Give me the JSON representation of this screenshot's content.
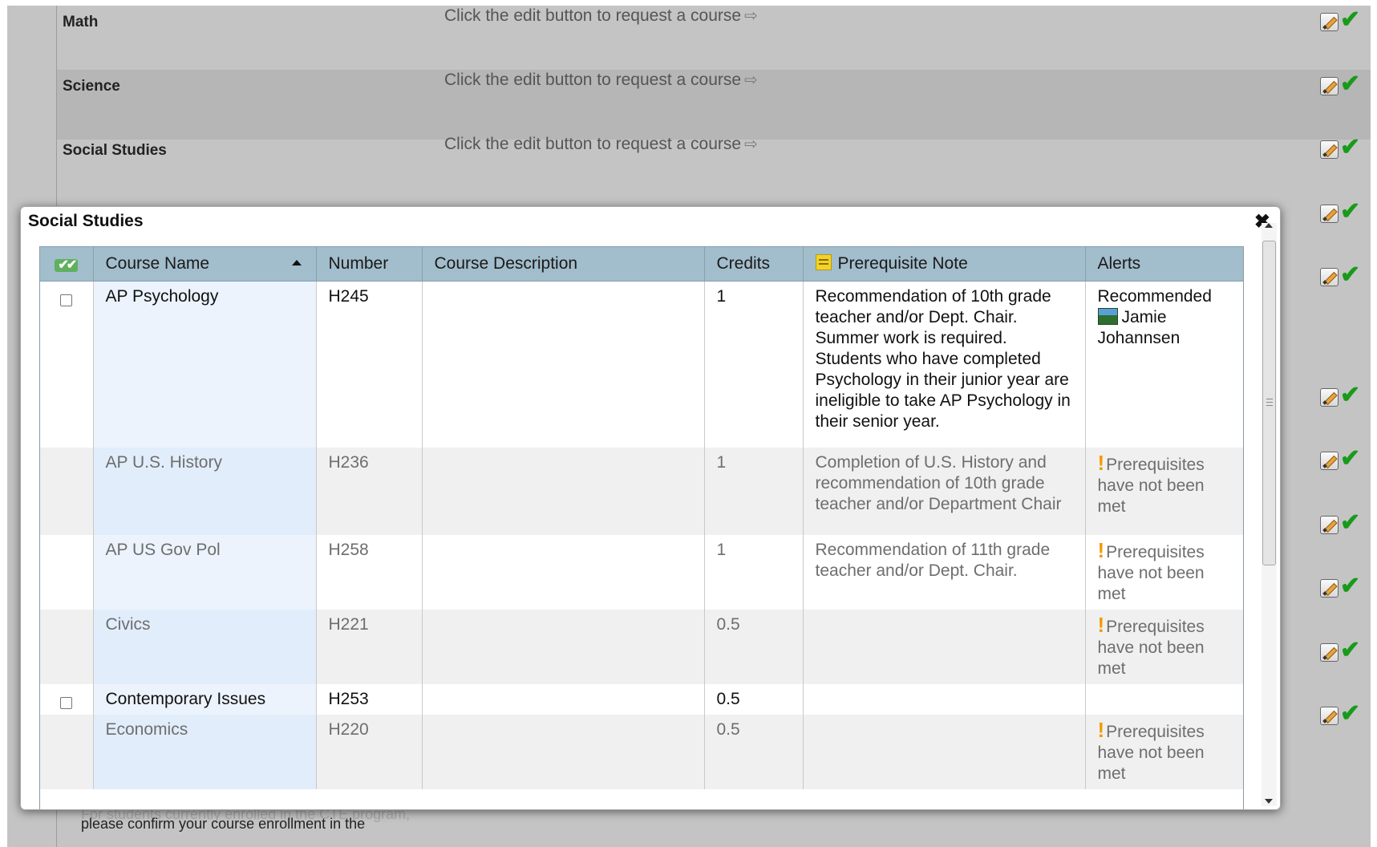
{
  "background": {
    "rows": [
      {
        "subject": "Math",
        "hint": "Click the edit button to request a course",
        "alt": false
      },
      {
        "subject": "Science",
        "hint": "Click the edit button to request a course",
        "alt": true
      },
      {
        "subject": "Social Studies",
        "hint": "Click the edit button to request a course",
        "alt": false
      }
    ],
    "footer_text": "please confirm your course enrollment in the",
    "footer_obscured_text": "For students currently enrolled in the CTE program,"
  },
  "modal": {
    "title": "Social Studies",
    "close_glyph": "✖",
    "columns": {
      "select_all_glyph": "✔✔",
      "course_name": "Course Name",
      "number": "Number",
      "description": "Course Description",
      "credits": "Credits",
      "prereq_note": "Prerequisite Note",
      "alerts": "Alerts"
    },
    "rows": [
      {
        "selectable": true,
        "name": "AP Psychology",
        "number": "H245",
        "description": "",
        "credits": "1",
        "prereq": "Recommendation of 10th grade teacher and/or Dept. Chair. Summer work is required. Students who have completed Psychology in their junior year are ineligible to take AP Psychology in their senior year.",
        "alert_type": "recommended",
        "alert_text": "Recommended",
        "recommender": "Jamie Johannsen"
      },
      {
        "selectable": false,
        "name": "AP U.S. History",
        "number": "H236",
        "description": "",
        "credits": "1",
        "prereq": "Completion of U.S. History and recommendation of 10th grade teacher and/or Department Chair",
        "alert_type": "warning",
        "alert_text": "Prerequisites have not been met",
        "recommender": ""
      },
      {
        "selectable": false,
        "name": "AP US Gov Pol",
        "number": "H258",
        "description": "",
        "credits": "1",
        "prereq": "Recommendation of 11th grade teacher and/or Dept. Chair.",
        "alert_type": "warning",
        "alert_text": "Prerequisites have not been met",
        "recommender": ""
      },
      {
        "selectable": false,
        "name": "Civics",
        "number": "H221",
        "description": "",
        "credits": "0.5",
        "prereq": "",
        "alert_type": "warning",
        "alert_text": "Prerequisites have not been met",
        "recommender": ""
      },
      {
        "selectable": true,
        "name": "Contemporary Issues",
        "number": "H253",
        "description": "",
        "credits": "0.5",
        "prereq": "",
        "alert_type": "none",
        "alert_text": "",
        "recommender": ""
      },
      {
        "selectable": false,
        "name": "Economics",
        "number": "H220",
        "description": "",
        "credits": "0.5",
        "prereq": "",
        "alert_type": "warning",
        "alert_text": "Prerequisites have not been met",
        "recommender": ""
      }
    ]
  },
  "icons": {
    "edit": "pencil-icon",
    "approve": "checkmark-icon",
    "warning": "exclamation-icon",
    "recommend": "road-icon",
    "note": "note-icon",
    "hint_arrow": "⇨",
    "warning_glyph": "!"
  },
  "colors": {
    "header_bg": "#a2bdcb",
    "name_col_bg": "#e1edfb",
    "check_green": "#1a9a1a",
    "warning_orange": "#f39a00"
  }
}
